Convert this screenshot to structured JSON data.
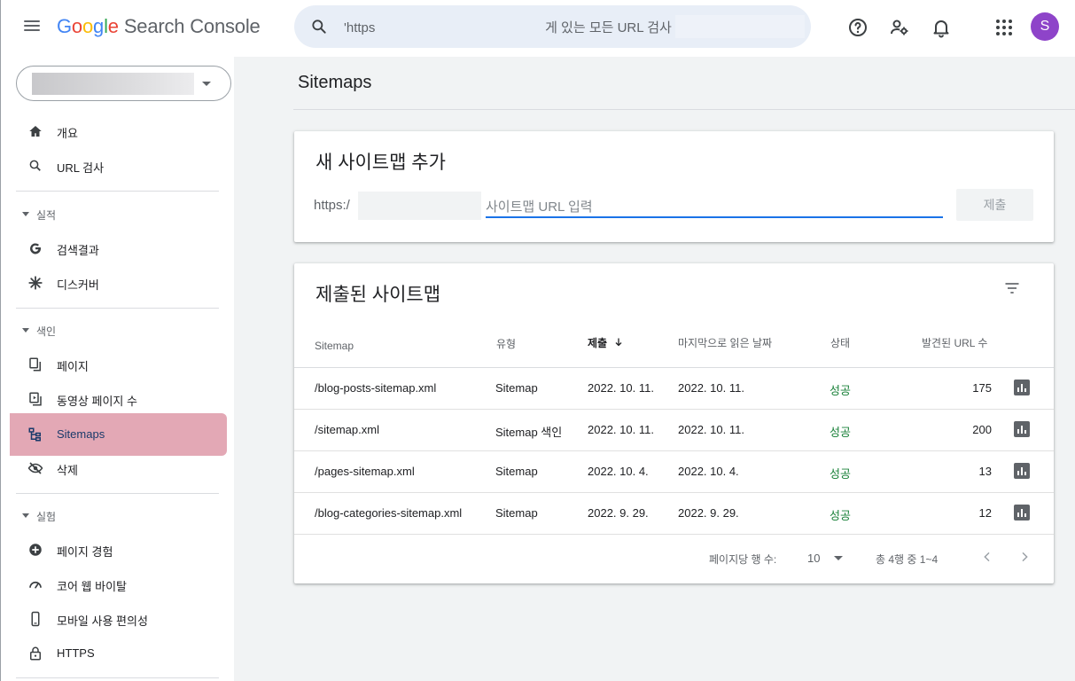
{
  "header": {
    "logo_letters": [
      "G",
      "o",
      "o",
      "g",
      "l",
      "e"
    ],
    "product_name": "Search Console",
    "search_prefix": "'https",
    "search_suffix": "게 있는 모든 URL 검사",
    "avatar_initial": "S",
    "avatar_color": "#8e44c9"
  },
  "sidebar": {
    "items": [
      {
        "label": "개요",
        "icon": "home-icon"
      },
      {
        "label": "URL 검사",
        "icon": "search-icon"
      },
      {
        "section": "실적"
      },
      {
        "label": "검색결과",
        "icon": "google-g-icon"
      },
      {
        "label": "디스커버",
        "icon": "asterisk-icon"
      },
      {
        "section": "색인"
      },
      {
        "label": "페이지",
        "icon": "pages-icon"
      },
      {
        "label": "동영상 페이지 수",
        "icon": "video-pages-icon"
      },
      {
        "label": "Sitemaps",
        "icon": "sitemap-icon",
        "active": true
      },
      {
        "label": "삭제",
        "icon": "eye-off-icon"
      },
      {
        "section": "실험"
      },
      {
        "label": "페이지 경험",
        "icon": "plus-circle-icon"
      },
      {
        "label": "코어 웹 바이탈",
        "icon": "gauge-icon"
      },
      {
        "label": "모바일 사용 편의성",
        "icon": "phone-icon"
      },
      {
        "label": "HTTPS",
        "icon": "lock-icon"
      }
    ]
  },
  "main": {
    "title": "Sitemaps",
    "add_card": {
      "title": "새 사이트맵 추가",
      "prefix": "https:/",
      "input_placeholder": "사이트맵 URL 입력",
      "submit_label": "제출"
    },
    "submitted_card": {
      "title": "제출된 사이트맵",
      "columns": [
        "Sitemap",
        "유형",
        "제출",
        "마지막으로 읽은 날짜",
        "상태",
        "발견된 URL 수"
      ],
      "rows": [
        {
          "sitemap": "/blog-posts-sitemap.xml",
          "type": "Sitemap",
          "submitted": "2022. 10. 11.",
          "last_read": "2022. 10. 11.",
          "status": "성공",
          "urls": "175"
        },
        {
          "sitemap": "/sitemap.xml",
          "type": "Sitemap 색인",
          "submitted": "2022. 10. 11.",
          "last_read": "2022. 10. 11.",
          "status": "성공",
          "urls": "200"
        },
        {
          "sitemap": "/pages-sitemap.xml",
          "type": "Sitemap",
          "submitted": "2022. 10. 4.",
          "last_read": "2022. 10. 4.",
          "status": "성공",
          "urls": "13"
        },
        {
          "sitemap": "/blog-categories-sitemap.xml",
          "type": "Sitemap",
          "submitted": "2022. 9. 29.",
          "last_read": "2022. 9. 29.",
          "status": "성공",
          "urls": "12"
        }
      ],
      "pager": {
        "rows_per_page_label": "페이지당 행 수:",
        "rows_per_page_value": "10",
        "range_label": "총 4행 중 1~4"
      }
    }
  },
  "colors": {
    "success": "#188038",
    "active_highlight": "#e3a8b5",
    "focus_underline": "#1a73e8"
  }
}
